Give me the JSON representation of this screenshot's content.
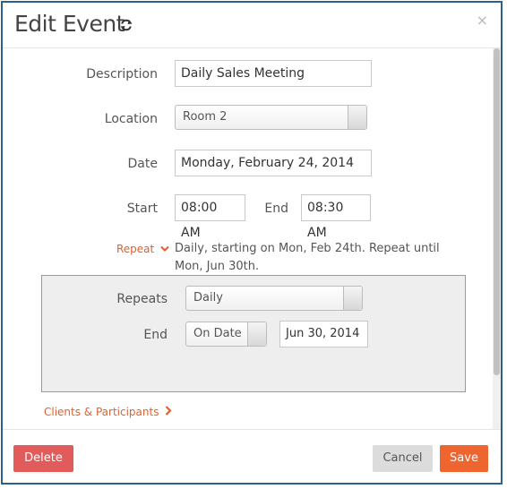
{
  "dialog": {
    "title": "Edit Event",
    "close_label": "×"
  },
  "form": {
    "description": {
      "label": "Description",
      "value": "Daily Sales Meeting"
    },
    "location": {
      "label": "Location",
      "value": "Room 2"
    },
    "date": {
      "label": "Date",
      "value": "Monday, February 24, 2014"
    },
    "start": {
      "label": "Start",
      "value": "08:00 AM"
    },
    "end": {
      "label": "End",
      "value": "08:30 AM"
    }
  },
  "repeat": {
    "link_label": "Repeat",
    "summary": "Daily, starting on Mon, Feb 24th. Repeat until Mon, Jun 30th.",
    "repeats_label": "Repeats",
    "repeats_value": "Daily",
    "end_label": "End",
    "end_type_value": "On Date",
    "end_date_value": "Jun 30, 2014"
  },
  "clients": {
    "link_label": "Clients & Participants"
  },
  "footer": {
    "delete_label": "Delete",
    "cancel_label": "Cancel",
    "save_label": "Save"
  },
  "colors": {
    "accent": "#e0622e",
    "delete": "#e15b5b",
    "save": "#ef6530",
    "border": "#2e5f86"
  },
  "icons": {
    "refresh": "refresh-icon",
    "close": "close-icon",
    "repeat_chevron": "chevron-down-icon",
    "clients_chevron": "chevron-right-icon"
  }
}
